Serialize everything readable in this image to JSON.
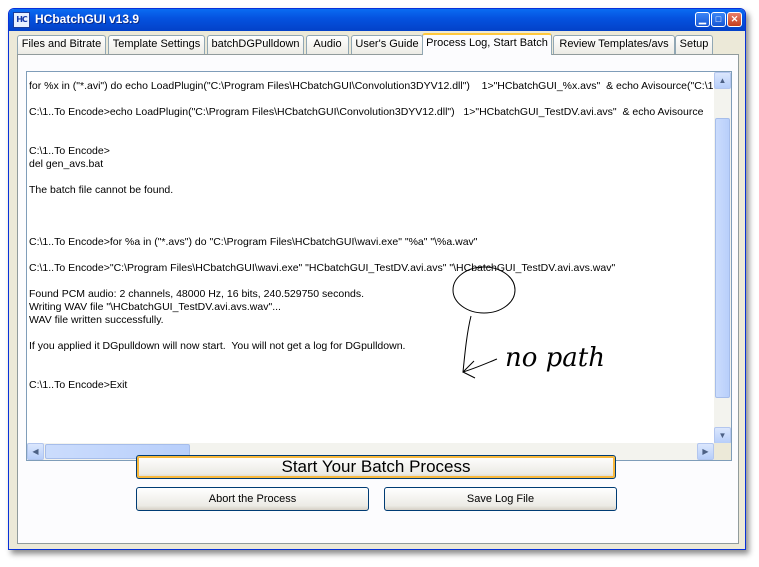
{
  "window": {
    "title": "HCbatchGUI v13.9",
    "icon_text": "HC",
    "controls": [
      "minimize-icon",
      "maximize-icon",
      "close-icon"
    ]
  },
  "tabs": [
    {
      "label": "Files and  Bitrate"
    },
    {
      "label": "Template Settings"
    },
    {
      "label": "batchDGPulldown"
    },
    {
      "label": "Audio"
    },
    {
      "label": "User's Guide"
    },
    {
      "label": "Process Log, Start Batch",
      "active": true
    },
    {
      "label": "Review Templates/avs"
    },
    {
      "label": "Setup"
    }
  ],
  "log": {
    "lines": [
      "for %x in (\"*.avi\") do echo LoadPlugin(\"C:\\Program Files\\HCbatchGUI\\Convolution3DYV12.dll\")    1>\"HCbatchGUI_%x.avs\"  & echo Avisource(\"C:\\1",
      "",
      "C:\\1..To Encode>echo LoadPlugin(\"C:\\Program Files\\HCbatchGUI\\Convolution3DYV12.dll\")   1>\"HCbatchGUI_TestDV.avi.avs\"  & echo Avisource",
      "",
      "",
      "C:\\1..To Encode>",
      "del gen_avs.bat",
      "",
      "The batch file cannot be found.",
      "",
      "",
      "",
      "C:\\1..To Encode>for %a in (\"*.avs\") do \"C:\\Program Files\\HCbatchGUI\\wavi.exe\" \"%a\" \"\\%a.wav\"",
      "",
      "C:\\1..To Encode>\"C:\\Program Files\\HCbatchGUI\\wavi.exe\" \"HCbatchGUI_TestDV.avi.avs\" \"\\HCbatchGUI_TestDV.avi.avs.wav\"",
      "",
      "Found PCM audio: 2 channels, 48000 Hz, 16 bits, 240.529750 seconds.",
      "Writing WAV file \"\\HCbatchGUI_TestDV.avi.avs.wav\"...",
      "WAV file written successfully.",
      "",
      "If you applied it DGpulldown will now start.  You will not get a log for DGpulldown.",
      "",
      "",
      "C:\\1..To Encode>Exit"
    ]
  },
  "annotation_text": "no path",
  "buttons": {
    "start": "Start Your Batch Process",
    "abort": "Abort the Process",
    "save_log": "Save Log File"
  },
  "colors": {
    "titlebar": "#0553e0",
    "active_tab_highlight": "#ffc83c",
    "window_face": "#ece9d8"
  }
}
